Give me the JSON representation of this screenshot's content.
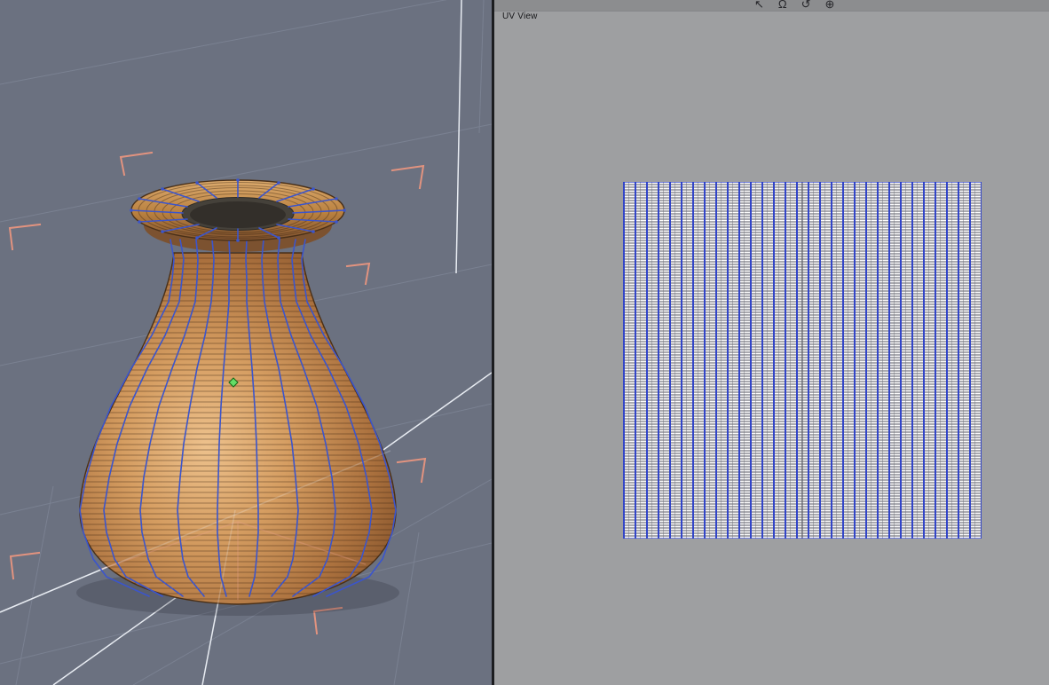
{
  "uv_view": {
    "label": "UV View",
    "grid": {
      "column_count": 31,
      "line_color": "#2a3ec8",
      "background": "#b5b6ba"
    }
  },
  "toolbar": {
    "icons": [
      {
        "name": "pointer-tool-icon",
        "glyph": "↖"
      },
      {
        "name": "magnet-snap-icon",
        "glyph": "Ω"
      },
      {
        "name": "rotate-view-icon",
        "glyph": "↺"
      },
      {
        "name": "settings-icon",
        "glyph": "⊕"
      }
    ]
  },
  "colors": {
    "viewport3d_background": "#6b7180",
    "grid_line": "#7a8191",
    "axis_line": "#e8ecf2",
    "workplane_handles": "#e2937f",
    "vase_surface": "#c8955f",
    "wireframe_selection": "#3b55cc",
    "action_center_marker": "#5ad55a",
    "uv_background": "#9e9fa1"
  }
}
